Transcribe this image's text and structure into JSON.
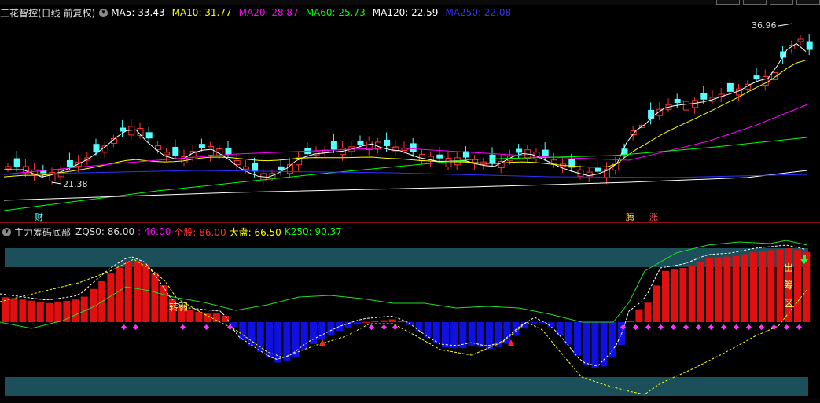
{
  "main": {
    "title": "三花智控(日线 前复权)",
    "ma": [
      {
        "label": "MA5: 33.43",
        "color": "#ffffff"
      },
      {
        "label": "MA10: 31.77",
        "color": "#ffff00"
      },
      {
        "label": "MA20: 28.87",
        "color": "#ff00ff"
      },
      {
        "label": "MA60: 25.73",
        "color": "#00ff00"
      },
      {
        "label": "MA120: 22.59",
        "color": "#ffffff"
      },
      {
        "label": "MA250: 22.08",
        "color": "#3030ff"
      }
    ],
    "high_label": "36.96",
    "low_label": "21.38",
    "event_tags": {
      "finance": "财",
      "up1": "腾",
      "up2": "涨"
    }
  },
  "indicator": {
    "title": "主力筹码底部",
    "values": [
      {
        "label": "ZQS0: 86.00",
        "color": "#dddddd"
      },
      {
        "label": ": 46.00",
        "color": "#ff00ff"
      },
      {
        "label": "个股: 86.00",
        "color": "#ff3333"
      },
      {
        "label": "大盘: 66.50",
        "color": "#ffff00"
      },
      {
        "label": "K250: 90.37",
        "color": "#00ff00"
      }
    ],
    "annotations": {
      "weak": "转弱",
      "out": "出",
      "chip": "筹",
      "zone": "区"
    }
  },
  "colors": {
    "up": "#ff3232",
    "down": "#54ffff",
    "bar_up": "#e01010",
    "bar_down": "#1010e0",
    "band": "#1b4f5a"
  }
}
